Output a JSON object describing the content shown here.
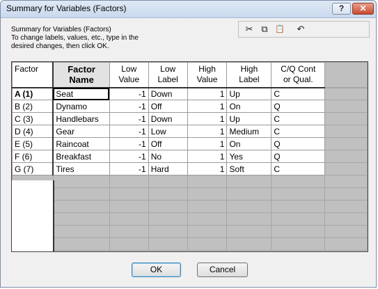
{
  "window": {
    "title": "Summary for Variables (Factors)",
    "help_label": "?",
    "close_label": "✕"
  },
  "info": {
    "line1": "Summary for Variables (Factors)",
    "line2": "To change labels, values, etc., type in the",
    "line3": "desired changes, then click OK."
  },
  "toolbar": {
    "cut_icon": "✂",
    "copy_icon": "⧉",
    "paste_icon": "📋",
    "undo_icon": "↶"
  },
  "table": {
    "corner_label": "Factor",
    "headers": {
      "name": [
        "Factor",
        "Name"
      ],
      "low_value": [
        "Low",
        "Value"
      ],
      "low_label": [
        "Low",
        "Label"
      ],
      "high_value": [
        "High",
        "Value"
      ],
      "high_label": [
        "High",
        "Label"
      ],
      "cq": [
        "C/Q Cont",
        "or Qual."
      ]
    },
    "rows": [
      {
        "id": "A  (1)",
        "name": "Seat",
        "low_value": "-1",
        "low_label": "Down",
        "high_value": "1",
        "high_label": "Up",
        "cq": "C"
      },
      {
        "id": "B  (2)",
        "name": "Dynamo",
        "low_value": "-1",
        "low_label": "Off",
        "high_value": "1",
        "high_label": "On",
        "cq": "Q"
      },
      {
        "id": "C  (3)",
        "name": "Handlebars",
        "low_value": "-1",
        "low_label": "Down",
        "high_value": "1",
        "high_label": "Up",
        "cq": "C"
      },
      {
        "id": "D  (4)",
        "name": "Gear",
        "low_value": "-1",
        "low_label": "Low",
        "high_value": "1",
        "high_label": "Medium",
        "cq": "C"
      },
      {
        "id": "E  (5)",
        "name": "Raincoat",
        "low_value": "-1",
        "low_label": "Off",
        "high_value": "1",
        "high_label": "On",
        "cq": "Q"
      },
      {
        "id": "F  (6)",
        "name": "Breakfast",
        "low_value": "-1",
        "low_label": "No",
        "high_value": "1",
        "high_label": "Yes",
        "cq": "Q"
      },
      {
        "id": "G  (7)",
        "name": "Tires",
        "low_value": "-1",
        "low_label": "Hard",
        "high_value": "1",
        "high_label": "Soft",
        "cq": "C"
      }
    ]
  },
  "buttons": {
    "ok": "OK",
    "cancel": "Cancel"
  }
}
